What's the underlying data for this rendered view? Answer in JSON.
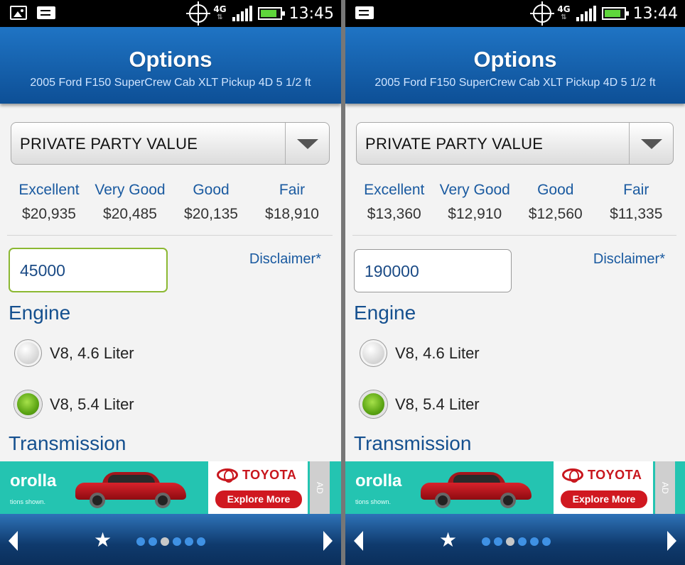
{
  "screens": [
    {
      "status": {
        "time": "13:45",
        "network": "4G"
      },
      "header": {
        "title": "Options",
        "subtitle": "2005 Ford F150 SuperCrew Cab XLT Pickup 4D 5 1/2 ft"
      },
      "dropdown": {
        "selected": "PRIVATE PARTY VALUE"
      },
      "values": [
        {
          "condition": "Excellent",
          "amount": "$20,935"
        },
        {
          "condition": "Very Good",
          "amount": "$20,485"
        },
        {
          "condition": "Good",
          "amount": "$20,135"
        },
        {
          "condition": "Fair",
          "amount": "$18,910"
        }
      ],
      "mileage": "45000",
      "disclaimer": "Disclaimer*",
      "engine": {
        "heading": "Engine",
        "options": [
          "V8, 4.6 Liter",
          "V8, 5.4 Liter"
        ],
        "selected": 1
      },
      "transmission": {
        "heading": "Transmission"
      },
      "ad": {
        "headline": "orolla",
        "fineprint": "tions shown.",
        "brand": "TOYOTA",
        "cta": "Explore More",
        "tag": "AD"
      },
      "pager": {
        "count": 6,
        "active": 2
      }
    },
    {
      "status": {
        "time": "13:44",
        "network": "4G"
      },
      "header": {
        "title": "Options",
        "subtitle": "2005 Ford F150 SuperCrew Cab XLT Pickup 4D 5 1/2 ft"
      },
      "dropdown": {
        "selected": "PRIVATE PARTY VALUE"
      },
      "values": [
        {
          "condition": "Excellent",
          "amount": "$13,360"
        },
        {
          "condition": "Very Good",
          "amount": "$12,910"
        },
        {
          "condition": "Good",
          "amount": "$12,560"
        },
        {
          "condition": "Fair",
          "amount": "$11,335"
        }
      ],
      "mileage": "190000",
      "disclaimer": "Disclaimer*",
      "engine": {
        "heading": "Engine",
        "options": [
          "V8, 4.6 Liter",
          "V8, 5.4 Liter"
        ],
        "selected": 1
      },
      "transmission": {
        "heading": "Transmission"
      },
      "ad": {
        "headline": "orolla",
        "fineprint": "tions shown.",
        "brand": "TOYOTA",
        "cta": "Explore More",
        "tag": "AD"
      },
      "pager": {
        "count": 6,
        "active": 2
      }
    }
  ],
  "colors": {
    "header_top": "#1f74c4",
    "header_bottom": "#0d4f96",
    "link": "#1a5aa0",
    "radio_on": "#5ca514",
    "ad_bg": "#24c4b1",
    "toyota_red": "#c8161d"
  }
}
